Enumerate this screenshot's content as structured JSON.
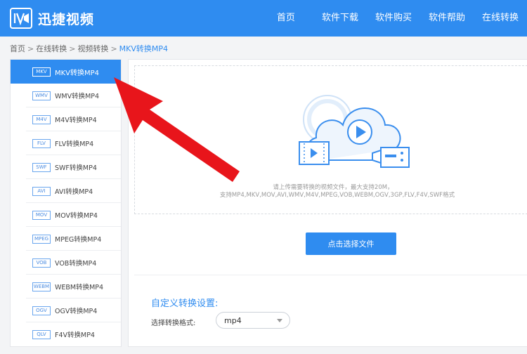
{
  "header": {
    "brand": "迅捷视频",
    "nav": [
      "首页",
      "软件下载",
      "软件购买",
      "软件帮助",
      "在线转换"
    ]
  },
  "breadcrumb": {
    "items": [
      "首页",
      "在线转换",
      "视频转换"
    ],
    "separator": ">",
    "current": "MKV转换MP4"
  },
  "sidebar": {
    "items": [
      {
        "tag": "MKV",
        "label": "MKV转换MP4",
        "active": true
      },
      {
        "tag": "WMV",
        "label": "WMV转换MP4"
      },
      {
        "tag": "M4V",
        "label": "M4V转换MP4"
      },
      {
        "tag": "FLV",
        "label": "FLV转换MP4"
      },
      {
        "tag": "SWF",
        "label": "SWF转换MP4"
      },
      {
        "tag": "AVI",
        "label": "AVI转换MP4"
      },
      {
        "tag": "MOV",
        "label": "MOV转换MP4"
      },
      {
        "tag": "MPEG",
        "label": "MPEG转换MP4"
      },
      {
        "tag": "VOB",
        "label": "VOB转换MP4"
      },
      {
        "tag": "WEBM",
        "label": "WEBM转换MP4"
      },
      {
        "tag": "OGV",
        "label": "OGV转换MP4"
      },
      {
        "tag": "QLV",
        "label": "F4V转换MP4"
      }
    ]
  },
  "upload": {
    "hint_line1": "请上传需要转换的视频文件，最大支持20M，",
    "hint_line2": "支持MP4,MKV,MOV,AVI,WMV,M4V,MPEG,VOB,WEBM,OGV,3GP,FLV,F4V,SWF格式",
    "button_label": "点击选择文件"
  },
  "settings": {
    "title": "自定义转换设置:",
    "format_label": "选择转换格式:",
    "format_value": "mp4"
  },
  "colors": {
    "accent": "#2f8cf0",
    "annotation_arrow": "#e8151b"
  }
}
